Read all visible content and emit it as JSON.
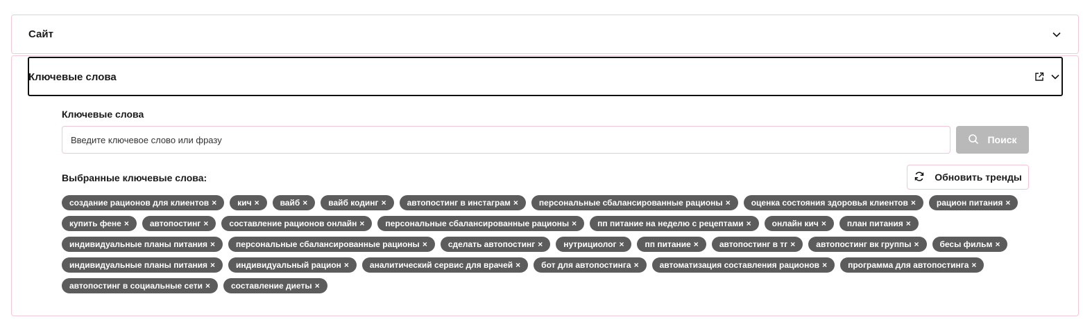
{
  "site_section": {
    "title": "Сайт"
  },
  "keywords_section": {
    "title": "Ключевые слова",
    "field_label": "Ключевые слова",
    "search_placeholder": "Введите ключевое слово или фразу",
    "search_button": "Поиск",
    "selected_label": "Выбранные ключевые слова:",
    "refresh_button": "Обновить тренды",
    "remove_glyph": "×",
    "tags": [
      "создание рационов для клиентов",
      "кич",
      "вайб",
      "вайб кодинг",
      "автопостинг в инстаграм",
      "персональные сбалансированные рационы",
      "оценка состояния здоровья клиентов",
      "рацион питания",
      "купить фене",
      "автопостинг",
      "составление рационов онлайн",
      "персональные сбалансированные рационы",
      "пп питание на неделю с рецептами",
      "онлайн кич",
      "план питания",
      "индивидуальные планы питания",
      "персональные сбалансированные рационы",
      "сделать автопостинг",
      "нутрициолог",
      "пп питание",
      "автопостинг в тг",
      "автопостинг вк группы",
      "бесы фильм",
      "индивидуальные планы питания",
      "индивидуальный рацион",
      "аналитический сервис для врачей",
      "бот для автопостинга",
      "автоматизация составления рационов",
      "программа для автопостинга",
      "автопостинг в социальные сети",
      "составление диеты"
    ]
  },
  "icons": {
    "site_toggle": "chevron-down-icon",
    "keywords_toggle": "chevron-down-icon",
    "external": "external-link-icon",
    "search": "search-icon",
    "refresh": "refresh-icon"
  },
  "colors": {
    "border_pink": "#f4c9d6",
    "tag_bg": "#5c5c5c",
    "search_button_bg": "#b9b9b9"
  }
}
